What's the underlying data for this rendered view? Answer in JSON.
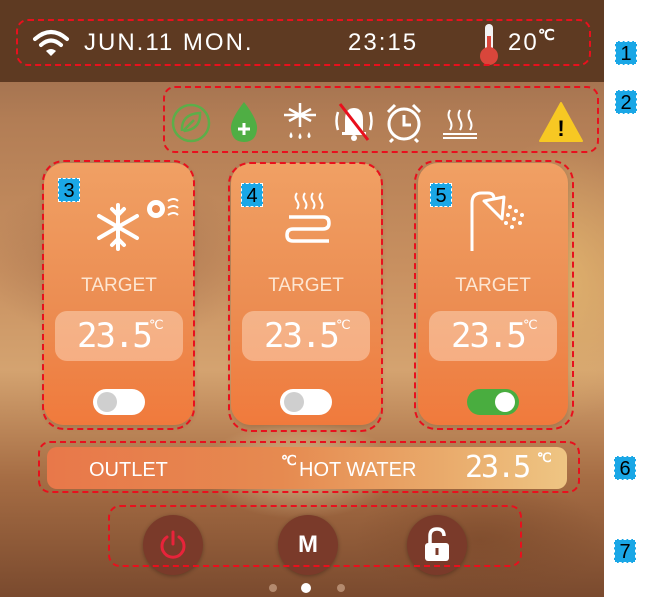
{
  "status_bar": {
    "date_label": "JUN.11 MON.",
    "time_label": "23:15",
    "ambient_temp": "20",
    "ambient_unit": "℃",
    "icons": [
      "wifi-icon",
      "thermometer-icon"
    ]
  },
  "status_icons": [
    "eco-leaf-icon",
    "water-drop-plus-icon",
    "defrost-icon",
    "mute-alarm-icon",
    "alarm-clock-icon",
    "floor-heating-icon",
    "warning-icon"
  ],
  "warning_glyph": "!",
  "modes": [
    {
      "name": "cooling",
      "target_label": "TARGET",
      "temp": "23.5",
      "unit": "℃",
      "enabled": false,
      "icon": "snowflake-fan-icon"
    },
    {
      "name": "heating",
      "target_label": "TARGET",
      "temp": "23.5",
      "unit": "℃",
      "enabled": false,
      "icon": "heating-coil-icon"
    },
    {
      "name": "hot-water",
      "target_label": "TARGET",
      "temp": "23.5",
      "unit": "℃",
      "enabled": true,
      "icon": "shower-icon"
    }
  ],
  "outlet_bar": {
    "outlet_label": "OUTLET",
    "outlet_unit": "℃",
    "hot_water_label": "HOT WATER",
    "hot_water_temp": "23.5",
    "hot_water_unit": "℃"
  },
  "controls": {
    "power_icon": "power-icon",
    "mode_label": "M",
    "lock_icon": "unlock-icon"
  },
  "pager": {
    "pages": 3,
    "active_page": 2
  },
  "callouts": [
    "1",
    "2",
    "3",
    "4",
    "5",
    "6",
    "7"
  ],
  "colors": {
    "highlight": "#e8101d",
    "callout": "#1aa7e6",
    "toggle_on": "#49ad3f",
    "header": "#5e3a22"
  }
}
